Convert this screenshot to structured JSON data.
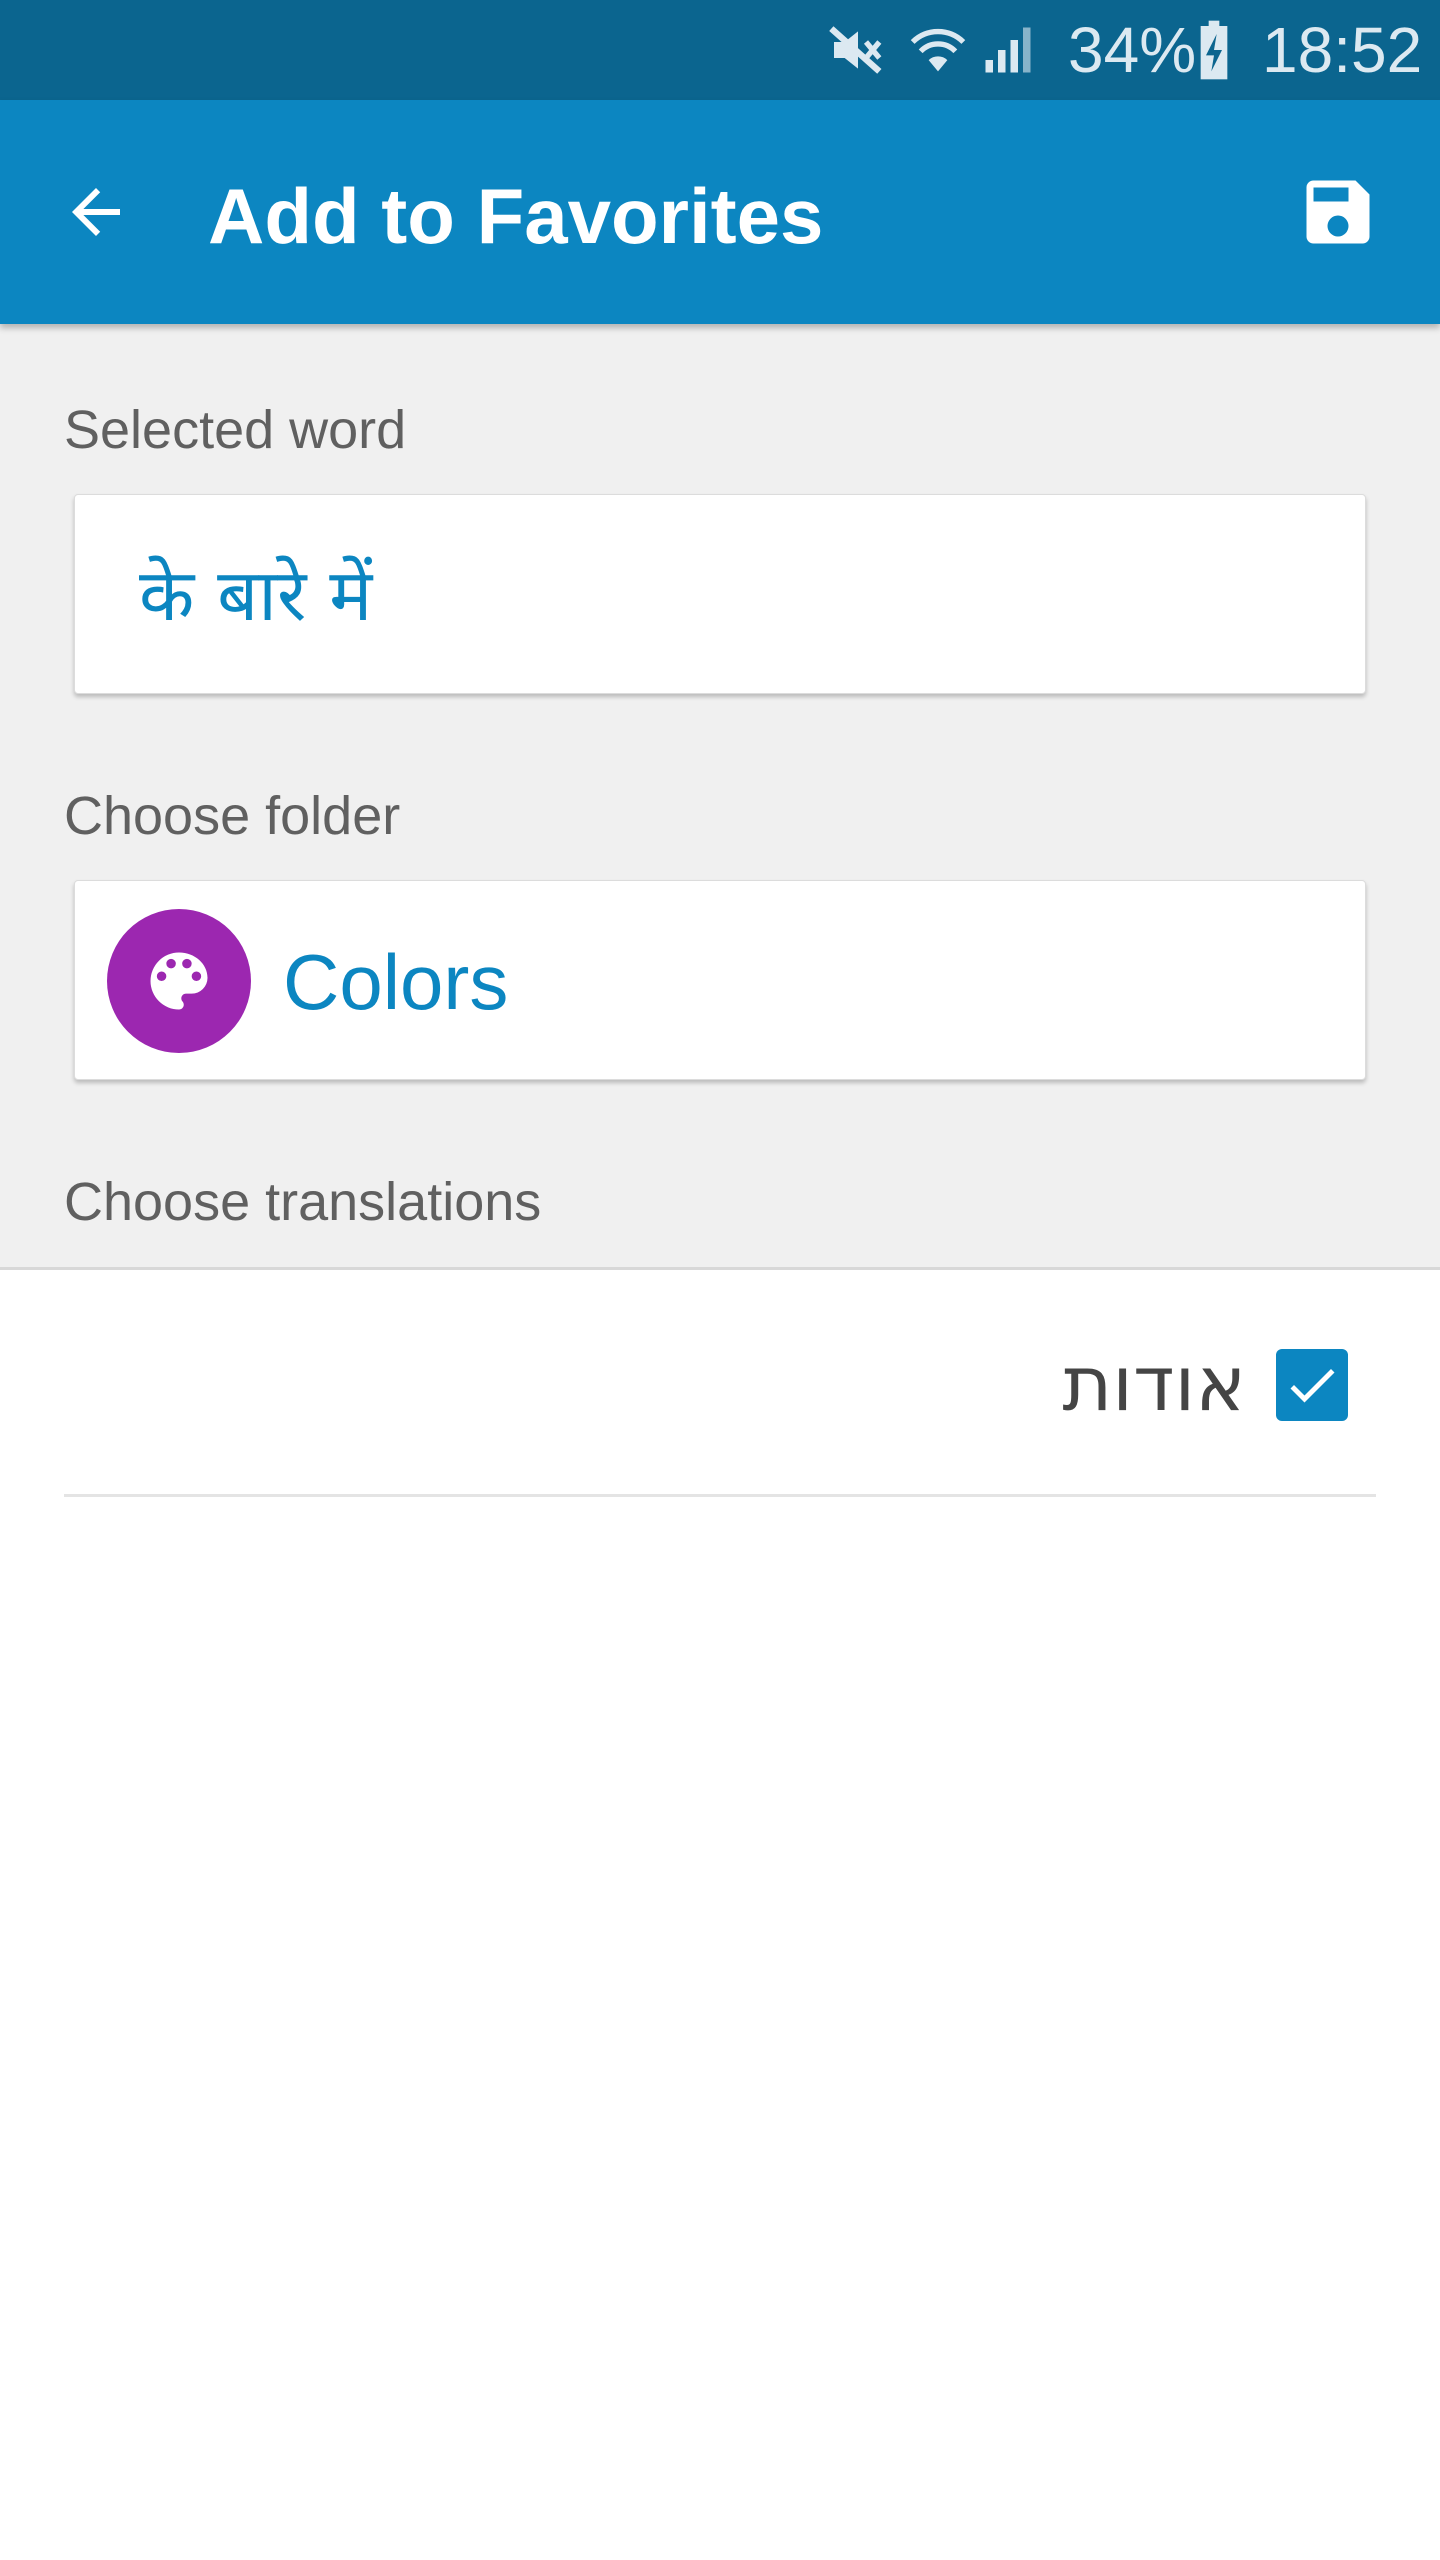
{
  "status_bar": {
    "battery_percent": "34%",
    "time": "18:52",
    "icons": [
      "mute-icon",
      "wifi-icon",
      "signal-icon",
      "battery-charging-icon"
    ]
  },
  "app_bar": {
    "title": "Add to Favorites",
    "back_icon": "arrow-left-icon",
    "save_icon": "floppy-save-icon"
  },
  "form": {
    "selected_word_label": "Selected word",
    "selected_word_value": "के बारे में",
    "choose_folder_label": "Choose folder",
    "folder": {
      "name": "Colors",
      "icon": "palette-icon",
      "color": "#9c27b0"
    },
    "choose_translations_label": "Choose translations"
  },
  "translations": [
    {
      "text": "אודות",
      "checked": true
    }
  ],
  "colors": {
    "status_bar": "#0b658f",
    "app_bar": "#0c86c1",
    "accent": "#0c86c1",
    "form_background": "#f0f0f0"
  }
}
